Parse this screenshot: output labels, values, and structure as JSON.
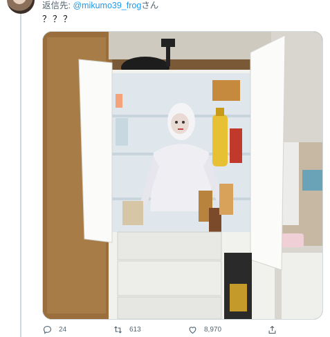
{
  "reply": {
    "prefix": "返信先: ",
    "handle": "@mikumo39_frog",
    "suffix": "さん"
  },
  "tweet": {
    "text": "？？？"
  },
  "actions": {
    "reply_count": "24",
    "retweet_count": "613",
    "like_count": "8,970"
  },
  "icons": {
    "reply": "reply-icon",
    "retweet": "retweet-icon",
    "like": "like-icon",
    "share": "share-icon"
  },
  "colors": {
    "accent": "#1d9bf0",
    "muted": "#536471"
  }
}
